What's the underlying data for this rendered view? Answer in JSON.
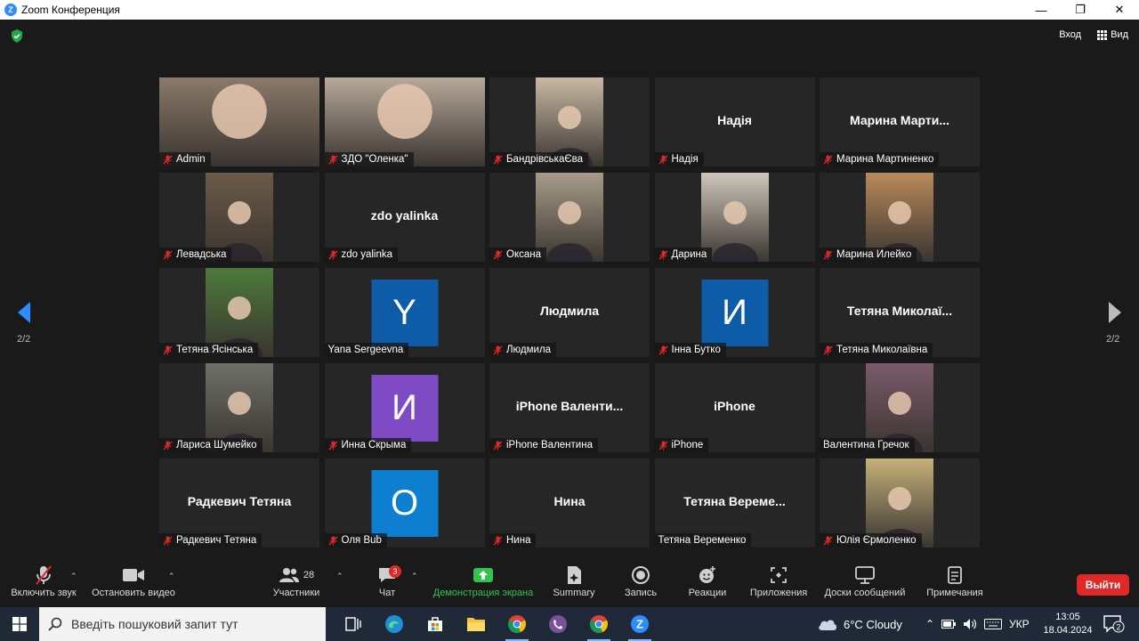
{
  "window": {
    "title": "Zoom Конференция"
  },
  "topbar": {
    "enter_label": "Вход",
    "view_label": "Вид"
  },
  "pager": {
    "left": "2/2",
    "right": "2/2"
  },
  "tiles": [
    {
      "name": "Admin",
      "muted": true,
      "kind": "photo-full",
      "bg": "#8a7a6a"
    },
    {
      "name": "ЗДО \"Оленка\"",
      "muted": true,
      "kind": "photo-full",
      "bg": "#b8a99a"
    },
    {
      "name": "БандрівськаЄва",
      "muted": true,
      "kind": "photo",
      "bg": "#c9b9a5"
    },
    {
      "name": "Надія",
      "muted": true,
      "kind": "text",
      "display": "Надія"
    },
    {
      "name": "Марина Мартиненко",
      "muted": true,
      "kind": "text",
      "display": "Марина  Марти..."
    },
    {
      "name": "Левадська",
      "muted": true,
      "kind": "photo",
      "bg": "#6b5a48"
    },
    {
      "name": "zdo yalinka",
      "muted": true,
      "kind": "text",
      "display": "zdo yalinka"
    },
    {
      "name": "Оксана",
      "muted": true,
      "kind": "photo",
      "bg": "#a89b8a"
    },
    {
      "name": "Дарина",
      "muted": true,
      "kind": "photo",
      "bg": "#cfc7bb"
    },
    {
      "name": "Марина Илейко",
      "muted": true,
      "kind": "photo",
      "bg": "#b88a5a"
    },
    {
      "name": "Тетяна Ясінська",
      "muted": true,
      "kind": "photo",
      "bg": "#4c7a3a"
    },
    {
      "name": "Yana Sergeevna",
      "muted": false,
      "kind": "avatar",
      "letter": "Y",
      "color": "#0e5ca8"
    },
    {
      "name": "Людмила",
      "muted": true,
      "kind": "text",
      "display": "Людмила"
    },
    {
      "name": "Інна Бутко",
      "muted": true,
      "kind": "avatar",
      "letter": "И",
      "color": "#0e5ca8"
    },
    {
      "name": "Тетяна Миколаївна",
      "muted": true,
      "kind": "text",
      "display": "Тетяна  Миколаї..."
    },
    {
      "name": "Лариса Шумейко",
      "muted": true,
      "kind": "photo",
      "bg": "#6e7068"
    },
    {
      "name": "Инна Скрыма",
      "muted": true,
      "kind": "avatar",
      "letter": "И",
      "color": "#7e4bc4"
    },
    {
      "name": "iPhone Валентина",
      "muted": true,
      "kind": "text",
      "display": "iPhone  Валенти..."
    },
    {
      "name": "iPhone",
      "muted": true,
      "kind": "text",
      "display": "iPhone"
    },
    {
      "name": "Валентина Гречок",
      "muted": false,
      "kind": "photo",
      "bg": "#7a5a6a"
    },
    {
      "name": "Радкевич Тетяна",
      "muted": true,
      "kind": "text",
      "display": "Радкевич Тетяна"
    },
    {
      "name": "Оля Bub",
      "muted": true,
      "kind": "avatar",
      "letter": "О",
      "color": "#0e7fd0"
    },
    {
      "name": "Нина",
      "muted": true,
      "kind": "text",
      "display": "Нина"
    },
    {
      "name": "Тетяна Веременко",
      "muted": false,
      "kind": "text",
      "display": "Тетяна  Вереме..."
    },
    {
      "name": "Юлія Єрмоленко",
      "muted": true,
      "kind": "photo",
      "bg": "#c6b07a"
    }
  ],
  "toolbar": {
    "audio": "Включить звук",
    "video": "Остановить видео",
    "participants": "Участники",
    "participants_count": "28",
    "chat": "Чат",
    "chat_badge": "3",
    "share": "Демонстрация экрана",
    "summary": "Summary",
    "record": "Запись",
    "reactions": "Реакции",
    "apps": "Приложения",
    "whiteboards": "Доски сообщений",
    "notes": "Примечания",
    "leave": "Выйти"
  },
  "taskbar": {
    "search_placeholder": "Введіть пошуковий запит тут",
    "weather": "6°C  Cloudy",
    "lang": "УКР",
    "time": "13:05",
    "date": "18.04.2024",
    "notif_count": "2"
  },
  "colors": {
    "accent_green": "#34c24f",
    "leave_red": "#e02828",
    "zoom_blue": "#2d8cff"
  }
}
